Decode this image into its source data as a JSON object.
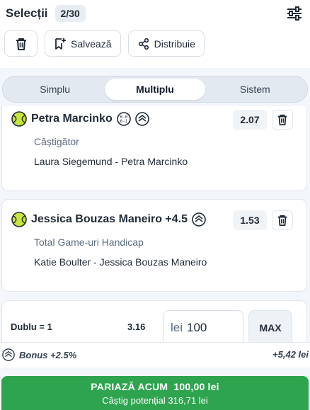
{
  "header": {
    "title": "Selecții",
    "count": "2/30",
    "actions": {
      "save_label": "Salvează",
      "share_label": "Distribuie"
    }
  },
  "tabs": [
    {
      "label": "Simplu",
      "active": false
    },
    {
      "label": "Multiplu",
      "active": true
    },
    {
      "label": "Sistem",
      "active": false
    }
  ],
  "selections": [
    {
      "player": "Petra Marcinko",
      "market": "Câștigător",
      "match": "Laura Siegemund - Petra Marcinko",
      "odd": "2.07"
    },
    {
      "player": "Jessica Bouzas Maneiro +4.5",
      "market": "Total Game-uri Handicap",
      "match": "Katie Boulter - Jessica Bouzas Maneiro",
      "odd": "1.53"
    }
  ],
  "stake": {
    "bet_type": "Dublu = 1",
    "total_odd": "3.16",
    "currency": "lei",
    "amount": "100",
    "max_label": "MAX"
  },
  "bonus": {
    "label": "Bonus +2.5%",
    "value": "+5,42 lei"
  },
  "place_bet": {
    "label": "PARIAZĂ ACUM  100,00 lei",
    "potential": "Câștig potențial 316,71 lei"
  },
  "colors": {
    "accent_green": "#2ea44f",
    "tennis_ball": "#c8e63a"
  },
  "icons": [
    "filter-icon",
    "trash-icon",
    "save-bookmark-icon",
    "share-icon",
    "tennis-ball-icon",
    "set-score-icon",
    "boost-icon"
  ]
}
